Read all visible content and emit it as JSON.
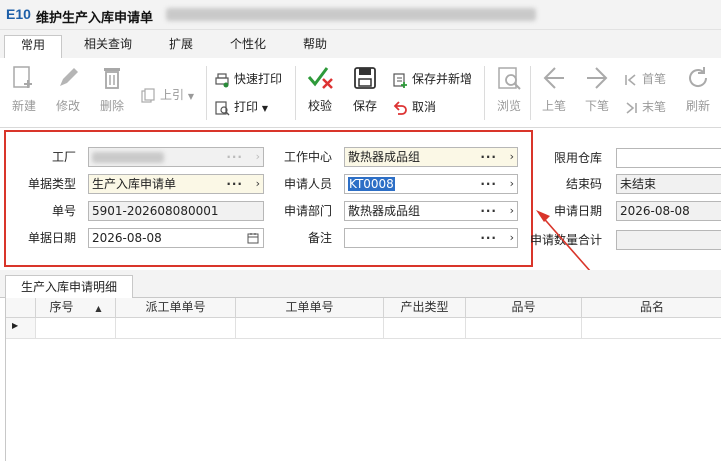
{
  "window": {
    "logo": "E10",
    "title": "维护生产入库申请单"
  },
  "menu": {
    "tabs": [
      "常用",
      "相关查询",
      "扩展",
      "个性化",
      "帮助"
    ]
  },
  "toolbar": {
    "new": "新建",
    "edit": "修改",
    "delete": "删除",
    "prev_ref": "上引",
    "quick_print": "快速打印",
    "print": "打印",
    "verify": "校验",
    "save": "保存",
    "save_new": "保存并新增",
    "cancel": "取消",
    "browse": "浏览",
    "prev": "上笔",
    "next": "下笔",
    "first": "首笔",
    "last": "末笔",
    "refresh": "刷新"
  },
  "form": {
    "factory": {
      "label": "工厂",
      "value": ""
    },
    "doc_type": {
      "label": "单据类型",
      "value": "生产入库申请单"
    },
    "doc_no": {
      "label": "单号",
      "value": "5901-202608080001"
    },
    "doc_date": {
      "label": "单据日期",
      "value": "2026-08-08"
    },
    "work_center": {
      "label": "工作中心",
      "value": "散热器成品组"
    },
    "applicant": {
      "label": "申请人员",
      "value": "KT0008"
    },
    "dept": {
      "label": "申请部门",
      "value": "散热器成品组"
    },
    "remark": {
      "label": "备注",
      "value": ""
    },
    "warehouse": {
      "label": "限用仓库",
      "value": ""
    },
    "close_code": {
      "label": "结束码",
      "value": "未结束"
    },
    "apply_date": {
      "label": "申请日期",
      "value": "2026-08-08"
    },
    "qty_total": {
      "label": "申请数量合计",
      "value": ""
    }
  },
  "detail": {
    "tab": "生产入库申请明细",
    "columns": [
      "序号",
      "派工单单号",
      "工单单号",
      "产出类型",
      "品号",
      "品名"
    ]
  },
  "colors": {
    "highlight": "#d9352a",
    "logo": "#1d5fa8",
    "selection": "#2d6fc6",
    "required_bg": "#fbf8e6"
  }
}
